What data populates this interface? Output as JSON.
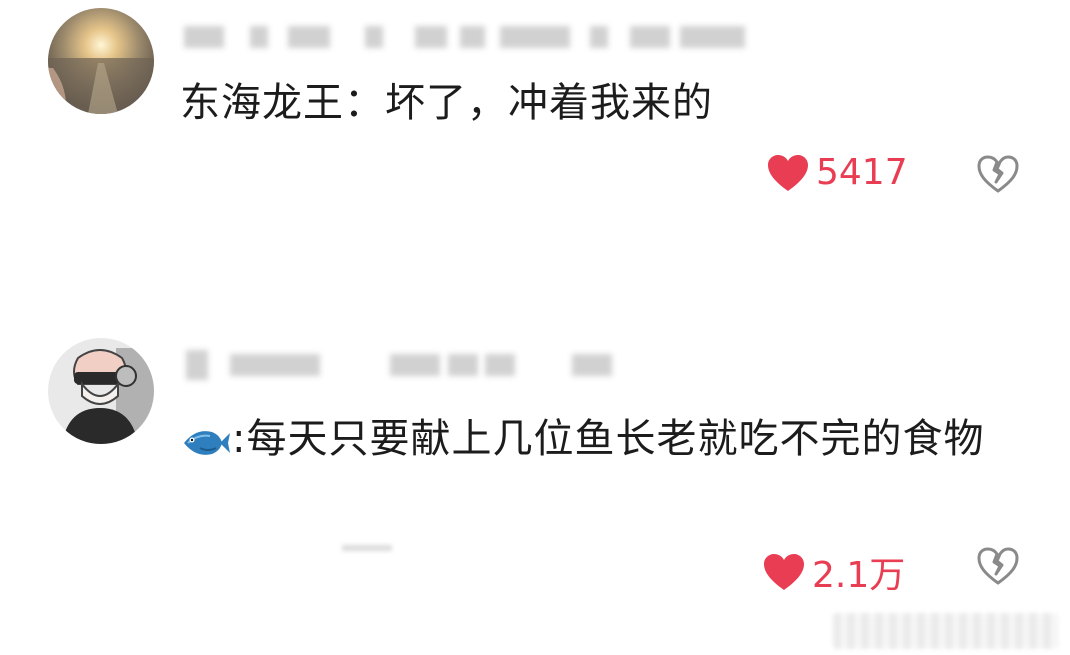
{
  "comments": [
    {
      "text": "东海龙王：坏了，冲着我来的",
      "likes": "5417",
      "liked": true
    },
    {
      "emoji_prefix": "fish-icon",
      "text": ":每天只要献上几位鱼长老就吃不完的食物",
      "likes": "2.1万",
      "liked": true
    }
  ],
  "colors": {
    "like_red": "#e83d52",
    "dislike_gray": "#8a8a8a",
    "text": "#1c1c1c",
    "fish_blue": "#2f7fbf"
  }
}
